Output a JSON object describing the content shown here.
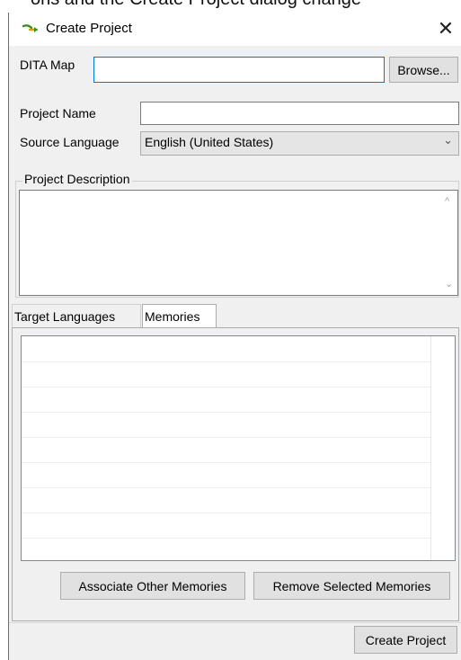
{
  "caption": {
    "text": "ons and the Create Project dialog change"
  },
  "window": {
    "title": "Create Project",
    "close_glyph": "✕",
    "icon": "project-arrow-icon"
  },
  "dita_map": {
    "label": "DITA Map",
    "value": "",
    "browse_label": "Browse..."
  },
  "project_name": {
    "label": "Project Name",
    "value": ""
  },
  "source_language": {
    "label": "Source Language",
    "selected": "English (United States)",
    "chevron": "⌄"
  },
  "description": {
    "legend": "Project Description",
    "value": "",
    "scroll_up": "^",
    "scroll_down": "⌄"
  },
  "tabs": [
    {
      "label": "Target Languages",
      "active": false
    },
    {
      "label": "Memories",
      "active": true
    }
  ],
  "memories_table": {
    "rows": []
  },
  "memory_buttons": {
    "associate_label": "Associate Other Memories",
    "remove_label": "Remove Selected Memories"
  },
  "footer": {
    "create_label": "Create Project"
  },
  "colors": {
    "focus_border": "#0078d7",
    "dialog_bg": "#f0f0f0",
    "button_bg": "#e1e1e1",
    "icon_green": "#3a8f1c"
  }
}
